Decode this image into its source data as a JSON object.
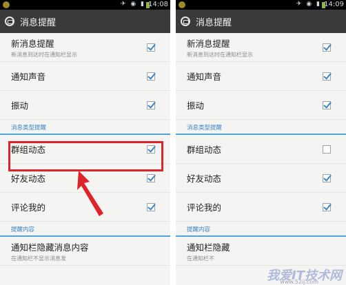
{
  "left": {
    "status_time": "14:08",
    "title": "消息提醒",
    "rows_top": [
      {
        "label": "新消息提醒",
        "sub": "新消息到达时在通知栏显示",
        "checked": true
      },
      {
        "label": "通知声音",
        "sub": "",
        "checked": true
      },
      {
        "label": "振动",
        "sub": "",
        "checked": true
      }
    ],
    "section1": "消息类型提醒",
    "rows_mid": [
      {
        "label": "群组动态",
        "checked": true
      },
      {
        "label": "好友动态",
        "checked": true
      },
      {
        "label": "评论我的",
        "checked": true
      }
    ],
    "section2": "提醒内容",
    "bottom_row": {
      "label": "通知栏隐藏消息内容",
      "sub": "在通知栏不显示消息发"
    }
  },
  "right": {
    "status_time": "14:09",
    "title": "消息提醒",
    "rows_top": [
      {
        "label": "新消息提醒",
        "sub": "新消息到达时在通知栏显示",
        "checked": true
      },
      {
        "label": "通知声音",
        "sub": "",
        "checked": true
      },
      {
        "label": "振动",
        "sub": "",
        "checked": true
      }
    ],
    "section1": "消息类型提醒",
    "rows_mid": [
      {
        "label": "群组动态",
        "checked": false
      },
      {
        "label": "好友动态",
        "checked": true
      },
      {
        "label": "评论我的",
        "checked": true
      }
    ],
    "section2": "提醒内容",
    "bottom_row": {
      "label": "通知栏隐藏",
      "sub": "在通知栏不"
    }
  },
  "watermark": {
    "text": "我爱IT技术网",
    "url": "www.52ij.com"
  },
  "colors": {
    "accent": "#3a86c8",
    "highlight": "#e0222a"
  }
}
